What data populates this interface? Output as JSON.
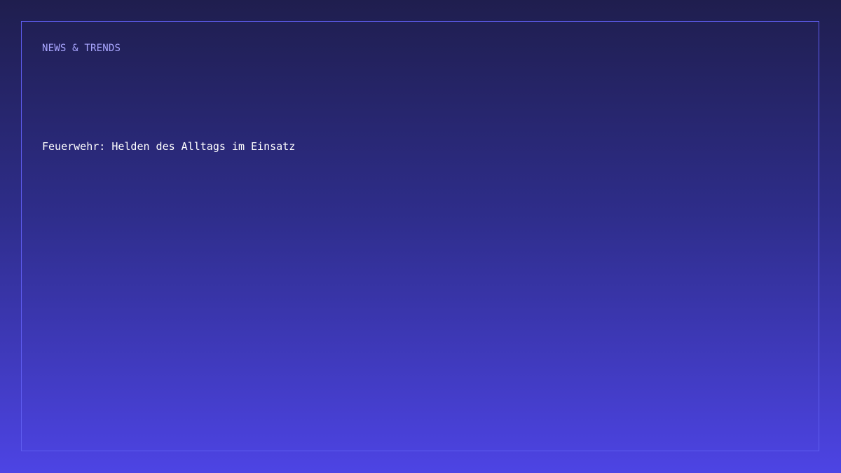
{
  "card": {
    "kicker": "NEWS & TRENDS",
    "headline": "Feuerwehr: Helden des Alltags im Einsatz"
  },
  "colors": {
    "background_top": "#1f1e4e",
    "background_bottom": "#4d44e4",
    "frame_border": "#5f5df0",
    "kicker_text": "#a9a6ff",
    "headline_text": "#ffffff"
  }
}
